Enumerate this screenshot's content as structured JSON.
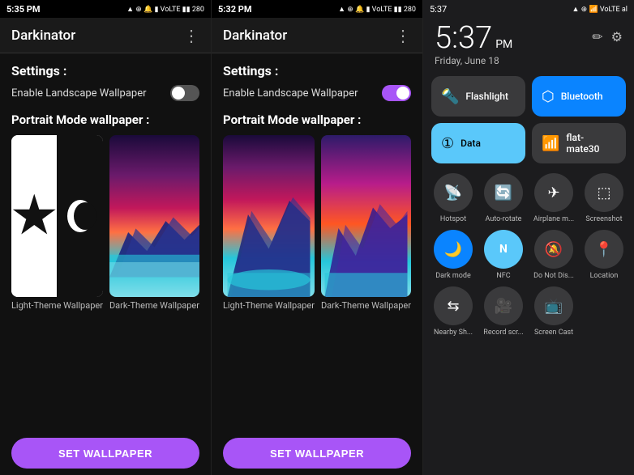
{
  "panel1": {
    "status_time": "5:35 PM",
    "status_icons": "▲ ☆ ⊕ 🔔 📶 VoLTE ▮▮ 280",
    "app_title": "Darkinator",
    "menu": "⋮",
    "settings_label": "Settings :",
    "toggle_label": "Enable Landscape Wallpaper",
    "toggle_state": "off",
    "portrait_label": "Portrait Mode wallpaper :",
    "light_caption": "Light-Theme Wallpaper",
    "dark_caption": "Dark-Theme Wallpaper",
    "set_btn": "SET WALLPAPER"
  },
  "panel2": {
    "status_time": "5:32 PM",
    "status_icons": "▲ ☆ ⊕ 🔔 📶 VoLTE ▮▮ 280",
    "app_title": "Darkinator",
    "menu": "⋮",
    "settings_label": "Settings :",
    "toggle_label": "Enable Landscape Wallpaper",
    "toggle_state": "on",
    "portrait_label": "Portrait Mode wallpaper :",
    "light_caption": "Light-Theme Wallpaper",
    "dark_caption": "Dark-Theme Wallpaper",
    "set_btn": "SET WALLPAPER"
  },
  "qs": {
    "status_time": "5:37",
    "status_pm": "PM",
    "status_icons": "▲ ☆ ⊕ 📶 VoLTE ▮▮ al",
    "date": "Friday, June 18",
    "edit_icon": "✏",
    "settings_icon": "⚙",
    "tiles": [
      {
        "label": "Flashlight",
        "icon": "🔦",
        "state": "inactive"
      },
      {
        "label": "Bluetooth",
        "icon": "🔵",
        "state": "active-blue"
      },
      {
        "label": "Data",
        "icon": "ℹ",
        "state": "active-light"
      },
      {
        "label": "flat-mate30",
        "icon": "📶",
        "state": "inactive"
      }
    ],
    "small_tiles": [
      {
        "label": "Hotspot",
        "icon": "📡",
        "state": "inactive"
      },
      {
        "label": "Auto-rotate",
        "icon": "🔄",
        "state": "inactive"
      },
      {
        "label": "Airplane m...",
        "icon": "✈",
        "state": "inactive"
      },
      {
        "label": "Screenshot",
        "icon": "📱",
        "state": "inactive"
      },
      {
        "label": "Dark mode",
        "icon": "🌙",
        "state": "active-blue"
      },
      {
        "label": "NFC",
        "icon": "N",
        "state": "active-cyan"
      },
      {
        "label": "Do Not Dis...",
        "icon": "🔕",
        "state": "inactive"
      },
      {
        "label": "Location",
        "icon": "📍",
        "state": "inactive"
      },
      {
        "label": "Nearby Sh...",
        "icon": "⇆",
        "state": "inactive"
      },
      {
        "label": "Record scr...",
        "icon": "📷",
        "state": "inactive"
      },
      {
        "label": "Screen Cast",
        "icon": "📺",
        "state": "inactive"
      }
    ]
  }
}
